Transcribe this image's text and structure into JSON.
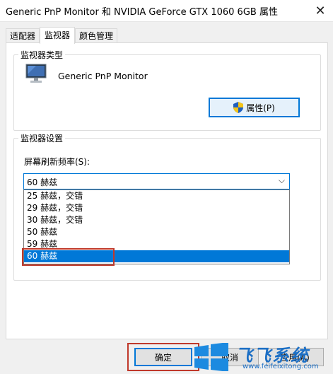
{
  "window": {
    "title": "Generic PnP Monitor 和 NVIDIA GeForce GTX 1060 6GB 属性",
    "close_glyph": "✕"
  },
  "tabs": [
    {
      "label": "适配器",
      "active": false
    },
    {
      "label": "监视器",
      "active": true
    },
    {
      "label": "颜色管理",
      "active": false
    }
  ],
  "monitor_type": {
    "legend": "监视器类型",
    "monitor_name": "Generic PnP Monitor",
    "properties_button": "属性(P)"
  },
  "monitor_settings": {
    "legend": "监视器设置",
    "refresh_label": "屏幕刷新频率(S):",
    "selected_value": "60 赫兹",
    "options": [
      "25 赫兹，交错",
      "29 赫兹，交错",
      "30 赫兹，交错",
      "50 赫兹",
      "59 赫兹",
      "60 赫兹"
    ],
    "selected_index": 5
  },
  "buttons": {
    "ok": "确定",
    "cancel": "取消",
    "apply": "应用(A)"
  },
  "watermark": {
    "text": "飞飞系统",
    "url": "www.feifeixitong.com"
  },
  "colors": {
    "accent": "#0078d7",
    "highlight_border": "#c0392b",
    "watermark": "#1c6fc5"
  }
}
